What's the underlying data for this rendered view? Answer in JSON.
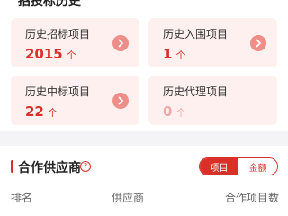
{
  "history": {
    "title": "招投标历史",
    "cards": [
      {
        "label": "历史招标项目",
        "value": "2015",
        "unit": "个",
        "has_arrow": true
      },
      {
        "label": "历史入围项目",
        "value": "1",
        "unit": "个",
        "has_arrow": true
      },
      {
        "label": "历史中标项目",
        "value": "22",
        "unit": "个",
        "has_arrow": true
      },
      {
        "label": "历史代理项目",
        "value": "0",
        "unit": "个",
        "has_arrow": false
      }
    ]
  },
  "suppliers": {
    "title": "合作供应商",
    "help_icon": "?",
    "toggle": {
      "project": "项目",
      "amount": "金额",
      "selected": "project"
    },
    "columns": {
      "rank": "排名",
      "supplier": "供应商",
      "count": "合作项目数"
    }
  },
  "colors": {
    "accent": "#d9302a",
    "card_bg": "#fdf0ef",
    "arrow_bg": "#ef8e88"
  }
}
